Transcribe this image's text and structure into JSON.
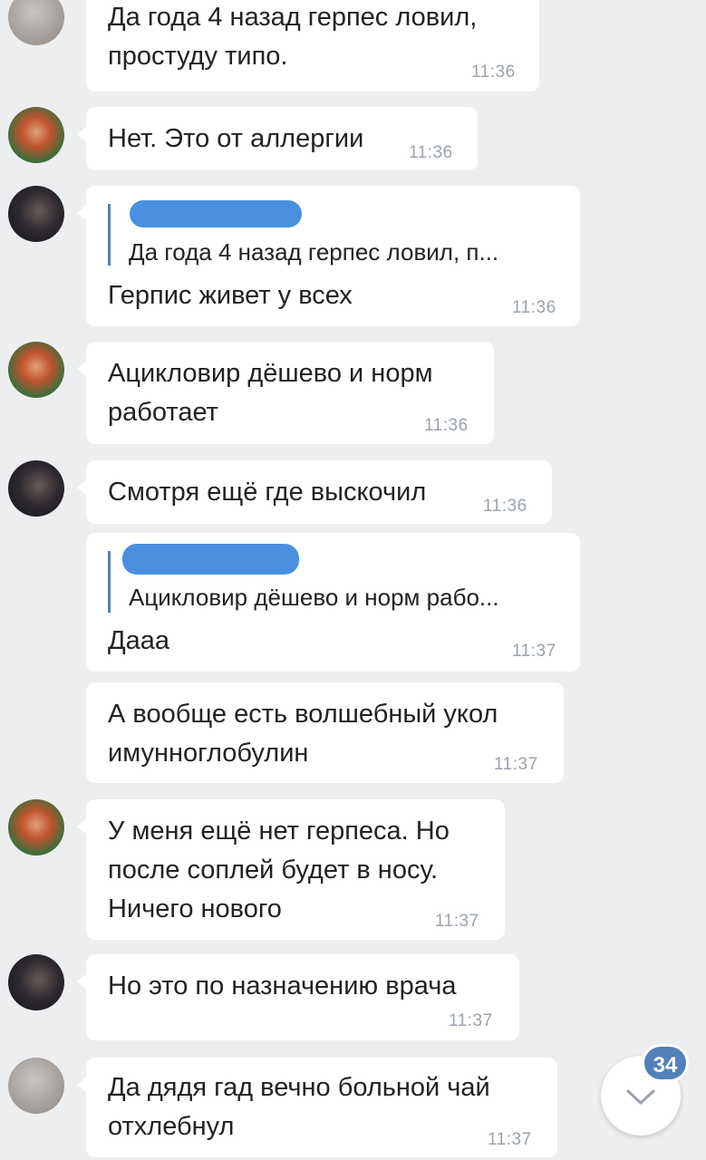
{
  "messages": [
    {
      "text": "Да года 4 назад герпес ловил,\nпростуду типо.",
      "time": "11:36"
    },
    {
      "text": "Нет. Это от аллергии",
      "time": "11:36"
    },
    {
      "quote": "Да года 4 назад герпес ловил, п...",
      "text": "Герпис живет у всех",
      "time": "11:36"
    },
    {
      "text": "Ацикловир дёшево и норм\nработает",
      "time": "11:36"
    },
    {
      "text": "Смотря ещё где выскочил",
      "time": "11:36"
    },
    {
      "quote": "Ацикловир дёшево и норм рабо...",
      "text": "Дааа",
      "time": "11:37"
    },
    {
      "text": "А вообще есть волшебный укол\nимунноглобулин",
      "time": "11:37"
    },
    {
      "text": "У меня ещё нет герпеса. Но\nпосле соплей будет в носу.\nНичего нового",
      "time": "11:37"
    },
    {
      "text": "Но это по назначению врача",
      "time": "11:37"
    },
    {
      "text": "Да дядя гад вечно больной чай\nотхлебнул",
      "time": "11:37"
    }
  ],
  "scroll_down": {
    "badge_count": "34",
    "icon": "chevron-down-icon"
  },
  "colors": {
    "background": "#edeef0",
    "accent": "#5181b8",
    "time": "#9aa2ab"
  }
}
